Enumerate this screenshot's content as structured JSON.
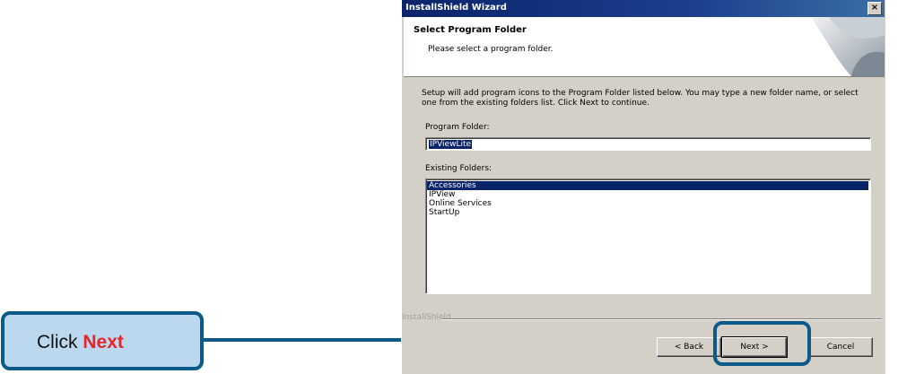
{
  "callout": {
    "prefix": "Click",
    "emphasis": "Next",
    "emphasis_color": "#e8242b",
    "border_color": "#0b5a8a",
    "fill_color": "#bcd8ef"
  },
  "dialog": {
    "title": "InstallShield Wizard",
    "close_glyph": "×",
    "header": {
      "title": "Select Program Folder",
      "subtitle": "Please select a program folder."
    },
    "description": "Setup will add program icons to the Program Folder listed below.  You may type a new folder name, or select one from the existing folders list.  Click Next to continue.",
    "program_folder_label": "Program Folder:",
    "program_folder_value": "IPViewLite",
    "existing_folders_label": "Existing Folders:",
    "existing_folders": [
      "Accessories",
      "IPView",
      "Online Services",
      "StartUp"
    ],
    "selected_index": 0,
    "brand": "InstallShield",
    "buttons": {
      "back": "< Back",
      "next": "Next >",
      "cancel": "Cancel"
    }
  }
}
